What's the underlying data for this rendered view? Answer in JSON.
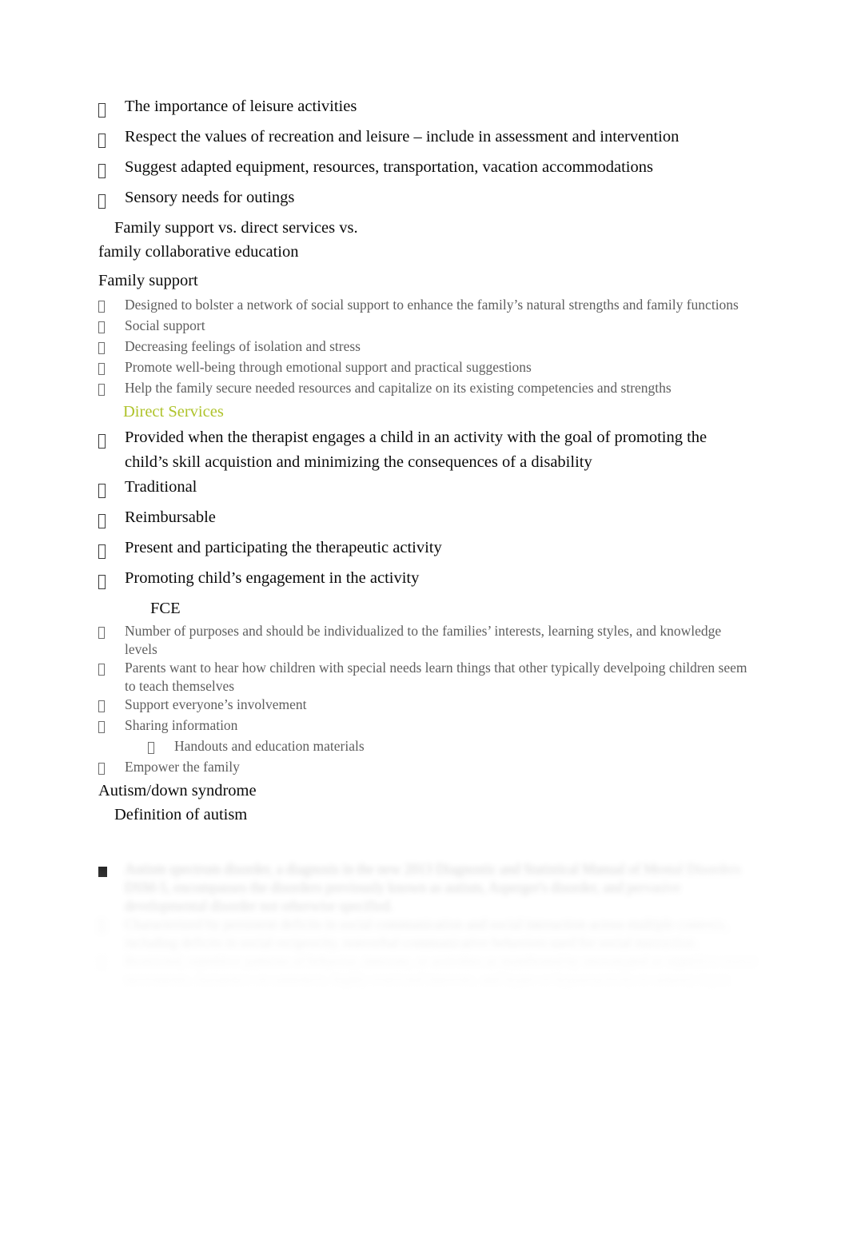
{
  "document": {
    "colors": {
      "body_text": "#0a0a0a",
      "secondary_text": "#5e5e5e",
      "accent_heading": "#AFC32B",
      "page_background": "#ffffff"
    },
    "bullet_glyphs": {
      "level_1": "missing-glyph-box",
      "level_2": "missing-glyph-box",
      "level_3": "missing-glyph-box",
      "square": "filled-square"
    },
    "blocks": [
      {
        "id": "b1",
        "level": "A",
        "bullet": "tofu",
        "text": "The importance of leisure activities"
      },
      {
        "id": "b2",
        "level": "A",
        "bullet": "tofu",
        "text": "Respect the values of recreation and leisure – include in assessment and intervention"
      },
      {
        "id": "b3",
        "level": "A",
        "bullet": "tofu",
        "text": "Suggest adapted equipment, resources, transportation, vacation accommodations"
      },
      {
        "id": "b4",
        "level": "A",
        "bullet": "tofu",
        "text": "Sensory needs for outings"
      },
      {
        "id": "h1",
        "level": "plain-ind1",
        "bullet": "none",
        "text": "Family support vs. direct services vs."
      },
      {
        "id": "h2",
        "level": "plain-ind0",
        "bullet": "none",
        "text": "family collaborative education"
      },
      {
        "id": "h3",
        "level": "plain-ind0",
        "bullet": "none",
        "text": "Family support"
      },
      {
        "id": "b5",
        "level": "B",
        "bullet": "tofu",
        "text": "Designed to bolster a network of social support to enhance the family’s natural strengths and family functions"
      },
      {
        "id": "b6",
        "level": "B",
        "bullet": "tofu",
        "text": "Social support"
      },
      {
        "id": "b7",
        "level": "B",
        "bullet": "tofu",
        "text": "Decreasing feelings of isolation and stress"
      },
      {
        "id": "b8",
        "level": "B",
        "bullet": "tofu",
        "text": "Promote well-being through emotional support and practical suggestions"
      },
      {
        "id": "b9",
        "level": "B",
        "bullet": "tofu",
        "text": "Help the family secure needed resources and capitalize on its existing competencies and strengths"
      },
      {
        "id": "h4",
        "level": "accent",
        "bullet": "none",
        "text": "Direct Services"
      },
      {
        "id": "b10",
        "level": "A",
        "bullet": "tofu",
        "text": "Provided when the therapist engages a child in an activity with the goal of promoting the child’s skill acquistion and minimizing the consequences of a disability"
      },
      {
        "id": "b11",
        "level": "A",
        "bullet": "tofu",
        "text": "Traditional"
      },
      {
        "id": "b12",
        "level": "A",
        "bullet": "tofu",
        "text": "Reimbursable"
      },
      {
        "id": "b13",
        "level": "A",
        "bullet": "tofu",
        "text": "Present and participating the therapeutic activity"
      },
      {
        "id": "b14",
        "level": "A",
        "bullet": "tofu",
        "text": "Promoting child’s engagement in the activity"
      },
      {
        "id": "h5",
        "level": "plain-ind2",
        "bullet": "none",
        "text": "FCE"
      },
      {
        "id": "b15",
        "level": "B",
        "bullet": "tofu",
        "text": "Number of purposes and should be individualized to the families’ interests, learning styles, and knowledge levels"
      },
      {
        "id": "b16",
        "level": "B",
        "bullet": "tofu",
        "text": "Parents want to hear how children with special needs learn things that other typically develpoing children seem to teach themselves"
      },
      {
        "id": "b17",
        "level": "B",
        "bullet": "tofu",
        "text": "Support everyone’s involvement"
      },
      {
        "id": "b18",
        "level": "B",
        "bullet": "tofu",
        "text": "Sharing information"
      },
      {
        "id": "b19",
        "level": "C",
        "bullet": "tofu",
        "text": "Handouts and education materials"
      },
      {
        "id": "b20",
        "level": "B",
        "bullet": "tofu",
        "text": "Empower the family"
      },
      {
        "id": "h6",
        "level": "plain-ind0",
        "bullet": "none",
        "text": "Autism/down syndrome"
      },
      {
        "id": "h7",
        "level": "plain-ind1",
        "bullet": "none",
        "text": "Definition of autism"
      }
    ],
    "faded_tail": {
      "note": "illegible — blurred / faded out",
      "items": [
        {
          "bullet": "square",
          "text": "Autism spectrum disorder, a diagnosis in the new 2013 Diagnostic and Statistical Manual of Mental Disorders DSM-5, encompasses the disorders previously known as autism, Asperger's disorder, and pervasive developmental disorder not otherwise specified."
        },
        {
          "bullet": "tofu",
          "text": "Characterized by persistent deficits in social communication and social interaction across multiple contexts, including deficits in social reciprocity, nonverbal communicative behaviors used for social interaction."
        },
        {
          "bullet": "tofu",
          "text": "Restricted, repetitive patterns of behavior, interests, or activities as manifested by stereotyped or repetitive motor movements, insistence on sameness, highly restricted interests, and hyper or hyporeactivity to sensory input."
        }
      ]
    }
  }
}
